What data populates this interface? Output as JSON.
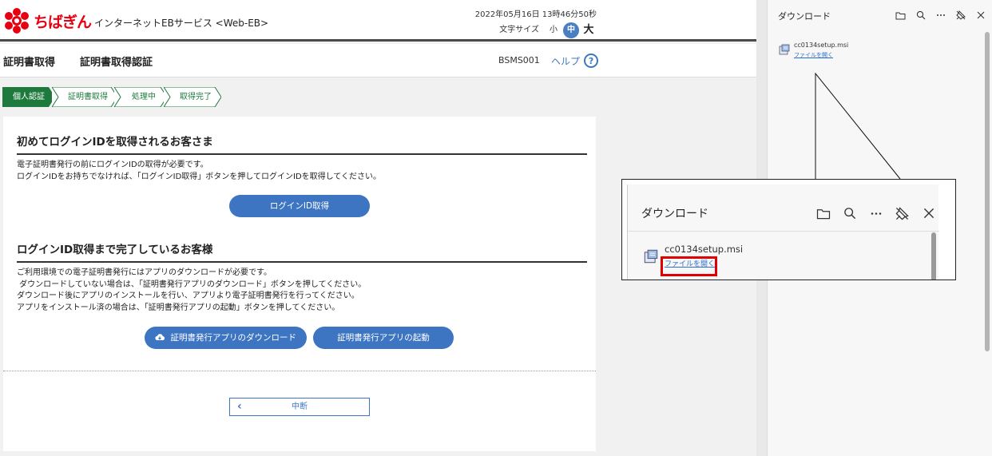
{
  "header": {
    "brand": "ちばぎん",
    "service": "インターネットEBサービス <Web-EB>",
    "datetime": "2022年05月16日 13時46分50秒",
    "fontsize_label": "文字サイズ",
    "fontsize_small": "小",
    "fontsize_medium": "中",
    "fontsize_large": "大"
  },
  "title_bar": {
    "title": "証明書取得",
    "subtitle": "証明書取得認証",
    "screen_id": "BSMS001",
    "help_label": "ヘルプ",
    "help_icon_glyph": "?"
  },
  "steps": [
    {
      "label": "個人認証",
      "active": true
    },
    {
      "label": "証明書取得",
      "active": false
    },
    {
      "label": "処理中",
      "active": false
    },
    {
      "label": "取得完了",
      "active": false
    }
  ],
  "section1": {
    "title": "初めてログインIDを取得されるお客さま",
    "lines": [
      "電子証明書発行の前にログインIDの取得が必要です。",
      "ログインIDをお持ちでなければ、「ログインID取得」ボタンを押してログインIDを取得してください。"
    ],
    "button": "ログインID取得"
  },
  "section2": {
    "title": "ログインID取得まで完了しているお客様",
    "lines": [
      "ご利用環境での電子証明書発行にはアプリのダウンロードが必要です。",
      " ダウンロードしていない場合は、「証明書発行アプリのダウンロード」ボタンを押してください。",
      "ダウンロード後にアプリのインストールを行い、アプリより電子証明書発行を行ってください。",
      "アプリをインストール済の場合は、「証明書発行アプリの起動」ボタンを押してください。"
    ],
    "download_button": "証明書発行アプリのダウンロード",
    "launch_button": "証明書発行アプリの起動"
  },
  "cancel_button": "中断",
  "download_panel": {
    "title": "ダウンロード",
    "filename": "cc0134setup.msi",
    "open_link": "ファイルを開く",
    "tools": [
      "folder-icon",
      "search-icon",
      "more-icon",
      "pin-icon",
      "close-icon"
    ]
  },
  "colors": {
    "brand_red": "#e60012",
    "step_active": "#1e7a3c",
    "button_blue": "#3d75c3",
    "highlight_red": "#e00000"
  }
}
